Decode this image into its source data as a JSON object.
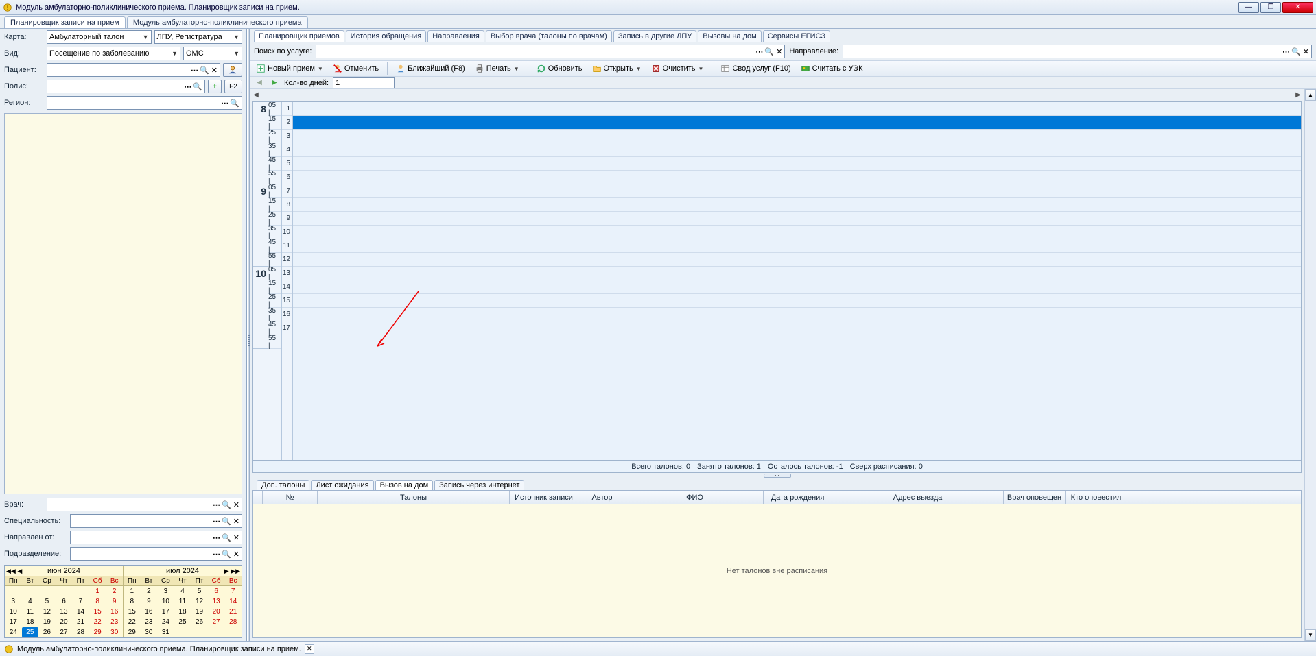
{
  "window": {
    "title": "Модуль амбулаторно-поликлинического приема. Планировщик записи на прием."
  },
  "moduleTabs": [
    "Планировщик записи на прием",
    "Модуль амбулаторно-поликлинического приема"
  ],
  "leftForm": {
    "karta_label": "Карта:",
    "karta_value": "Амбулаторный талон",
    "lpu_value": "ЛПУ, Регистратура",
    "vid_label": "Вид:",
    "vid_value": "Посещение по заболеванию",
    "oms_value": "ОМС",
    "pacient_label": "Пациент:",
    "polis_label": "Полис:",
    "region_label": "Регион:",
    "f2_label": "F2"
  },
  "filterForm": {
    "vrach_label": "Врач:",
    "spec_label": "Специальность:",
    "napr_label": "Направлен от:",
    "podr_label": "Подразделение:"
  },
  "calendar": {
    "month1": "июн 2024",
    "month2": "июл 2024",
    "dow": [
      "Пн",
      "Вт",
      "Ср",
      "Чт",
      "Пт",
      "Сб",
      "Вс"
    ],
    "june": [
      [
        "",
        "",
        "",
        "",
        "",
        "1",
        "2"
      ],
      [
        "3",
        "4",
        "5",
        "6",
        "7",
        "8",
        "9"
      ],
      [
        "10",
        "11",
        "12",
        "13",
        "14",
        "15",
        "16"
      ],
      [
        "17",
        "18",
        "19",
        "20",
        "21",
        "22",
        "23"
      ],
      [
        "24",
        "25",
        "26",
        "27",
        "28",
        "29",
        "30"
      ]
    ],
    "july": [
      [
        "1",
        "2",
        "3",
        "4",
        "5",
        "6",
        "7"
      ],
      [
        "8",
        "9",
        "10",
        "11",
        "12",
        "13",
        "14"
      ],
      [
        "15",
        "16",
        "17",
        "18",
        "19",
        "20",
        "21"
      ],
      [
        "22",
        "23",
        "24",
        "25",
        "26",
        "27",
        "28"
      ],
      [
        "29",
        "30",
        "31",
        "",
        "",
        "",
        ""
      ]
    ],
    "today": "25"
  },
  "rightTabs": [
    "Планировщик приемов",
    "История обращения",
    "Направления",
    "Выбор врача (талоны по врачам)",
    "Запись в другие ЛПУ",
    "Вызовы на дом",
    "Сервисы ЕГИСЗ"
  ],
  "search": {
    "uslugi_label": "Поиск по услуге:",
    "napr_label": "Направление:"
  },
  "toolbar": {
    "new": "Новый прием",
    "cancel": "Отменить",
    "nearest": "Ближайший (F8)",
    "print": "Печать",
    "refresh": "Обновить",
    "open": "Открыть",
    "clear": "Очистить",
    "svod": "Свод услуг (F10)",
    "uek": "Считать с УЭК"
  },
  "days": {
    "label": "Кол-во дней:",
    "value": "1"
  },
  "schedule": {
    "hours": [
      "8",
      "9",
      "10"
    ],
    "mins": [
      "05",
      "15",
      "25",
      "35",
      "45",
      "55"
    ],
    "slots": [
      "1",
      "2",
      "3",
      "4",
      "5",
      "6",
      "7",
      "8",
      "9",
      "10",
      "11",
      "12",
      "13",
      "14",
      "15",
      "16",
      "17"
    ],
    "selected_slot_index": 1
  },
  "status": {
    "total_label": "Всего талонов:",
    "total": "0",
    "busy_label": "Занято талонов:",
    "busy": "1",
    "left_label": "Осталось талонов:",
    "left": "-1",
    "over_label": "Сверх расписания:",
    "over": "0"
  },
  "lowerTabs": [
    "Доп. талоны",
    "Лист ожидания",
    "Вызов на дом",
    "Запись через интернет"
  ],
  "table": {
    "columns": [
      "№",
      "Талоны",
      "Источник записи",
      "Автор",
      "ФИО",
      "Дата рождения",
      "Адрес выезда",
      "Врач оповещен",
      "Кто оповестил"
    ],
    "widths": [
      80,
      280,
      100,
      70,
      200,
      100,
      250,
      90,
      90
    ],
    "empty_msg": "Нет талонов вне расписания"
  },
  "footer": {
    "text": "Модуль амбулаторно-поликлинического приема. Планировщик записи на прием."
  }
}
